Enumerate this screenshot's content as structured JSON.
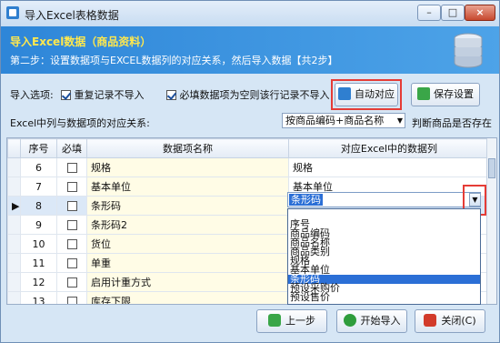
{
  "window": {
    "title": "导入Excel表格数据",
    "controls": {
      "minimize": "–",
      "maximize": "□",
      "close": "×"
    }
  },
  "banner": {
    "title": "导入Excel数据（商品资料）",
    "subtitle": "第二步：设置数据项与EXCEL数据列的对应关系，然后导入数据【共2步】",
    "icon": "database-icon"
  },
  "options": {
    "label": "导入选项:",
    "repeat_skip": {
      "label": "重复记录不导入",
      "checked": true
    },
    "required_skip": {
      "label": "必填数据项为空则该行记录不导入",
      "checked": true
    },
    "auto_map_button": "自动对应",
    "save_settings_button": "保存设置"
  },
  "mapping": {
    "label": "Excel中列与数据项的对应关系:",
    "key_select": "按商品编码+商品名称",
    "key_hint": "判断商品是否存在"
  },
  "grid": {
    "columns": [
      "序号",
      "必填",
      "数据项名称",
      "对应Excel中的数据列"
    ],
    "rows": [
      {
        "no": "6",
        "name": "规格",
        "map": "规格"
      },
      {
        "no": "7",
        "name": "基本单位",
        "map": "基本单位"
      },
      {
        "no": "8",
        "name": "条形码",
        "map": ""
      },
      {
        "no": "9",
        "name": "条形码2",
        "map": ""
      },
      {
        "no": "10",
        "name": "货位",
        "map": ""
      },
      {
        "no": "11",
        "name": "单重",
        "map": ""
      },
      {
        "no": "12",
        "name": "启用计重方式",
        "map": ""
      },
      {
        "no": "13",
        "name": "库存下限",
        "map": ""
      }
    ],
    "current_indicator": "▶",
    "editing_value": "条形码"
  },
  "dropdown": {
    "items": [
      "序号",
      "商品编码",
      "商品名称",
      "商品类别",
      "规格",
      "基本单位",
      "条形码",
      "预设采购价",
      "预设售价"
    ],
    "selected": "条形码"
  },
  "footer": {
    "prev": "上一步",
    "start": "开始导入",
    "close": "关闭(C)"
  }
}
